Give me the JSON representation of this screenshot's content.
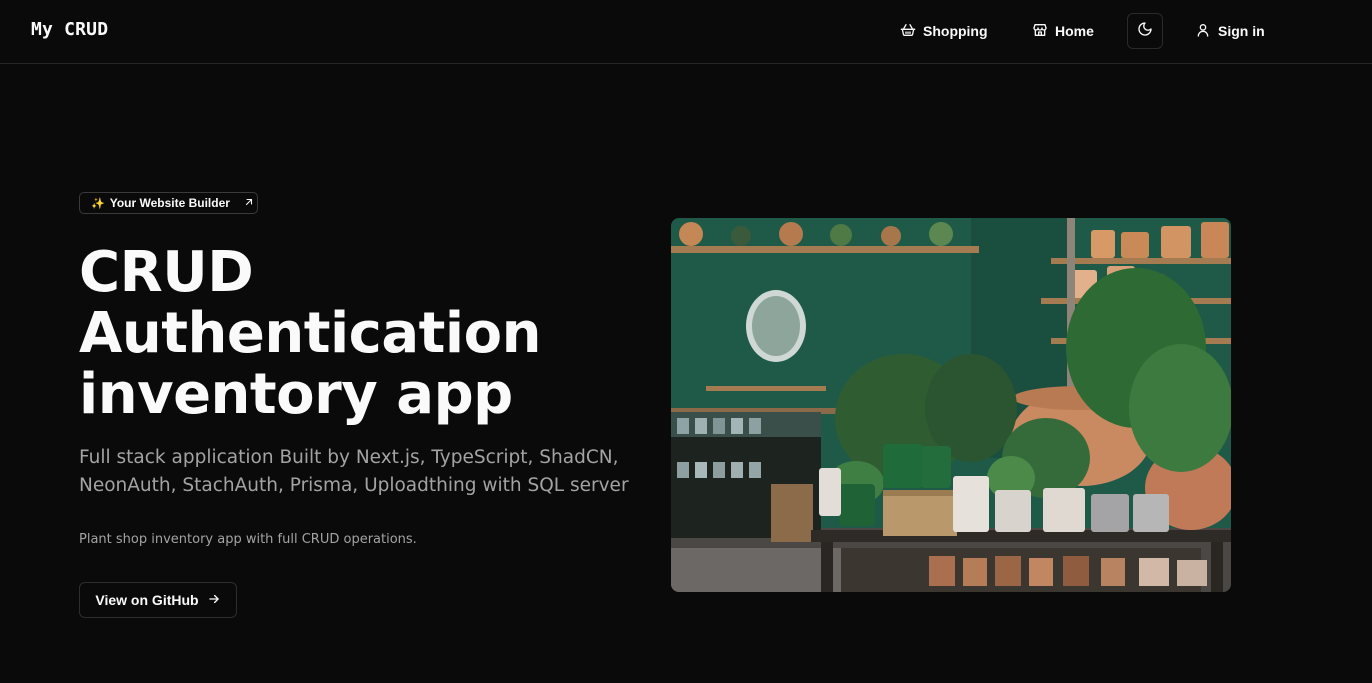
{
  "brand": "My CRUD",
  "nav": {
    "shopping": "Shopping",
    "home": "Home",
    "signin": "Sign in"
  },
  "icons": {
    "shopping": "basket-icon",
    "home": "store-icon",
    "theme": "moon-icon",
    "signin": "user-icon",
    "badge_arrow": "arrow-up-right-icon",
    "button_arrow": "arrow-right-icon",
    "badge_spark": "sparkles-icon"
  },
  "hero": {
    "badge_spark": "✨",
    "badge_label": "Your Website Builder",
    "title_line1": "CRUD",
    "title_line2": "Authentication",
    "title_line3": "inventory app",
    "subtitle": "Full stack application Built by Next.js, TypeScript, ShadCN, NeonAuth, StachAuth, Prisma, Uploadthing with SQL server",
    "description": "Plant shop inventory app with full CRUD operations.",
    "button_label": "View on GitHub"
  },
  "colors": {
    "background": "#0a0a0a",
    "foreground": "#fafafa",
    "muted": "#a3a3a3",
    "border": "#262626",
    "wall_green": "#1f5a48"
  }
}
